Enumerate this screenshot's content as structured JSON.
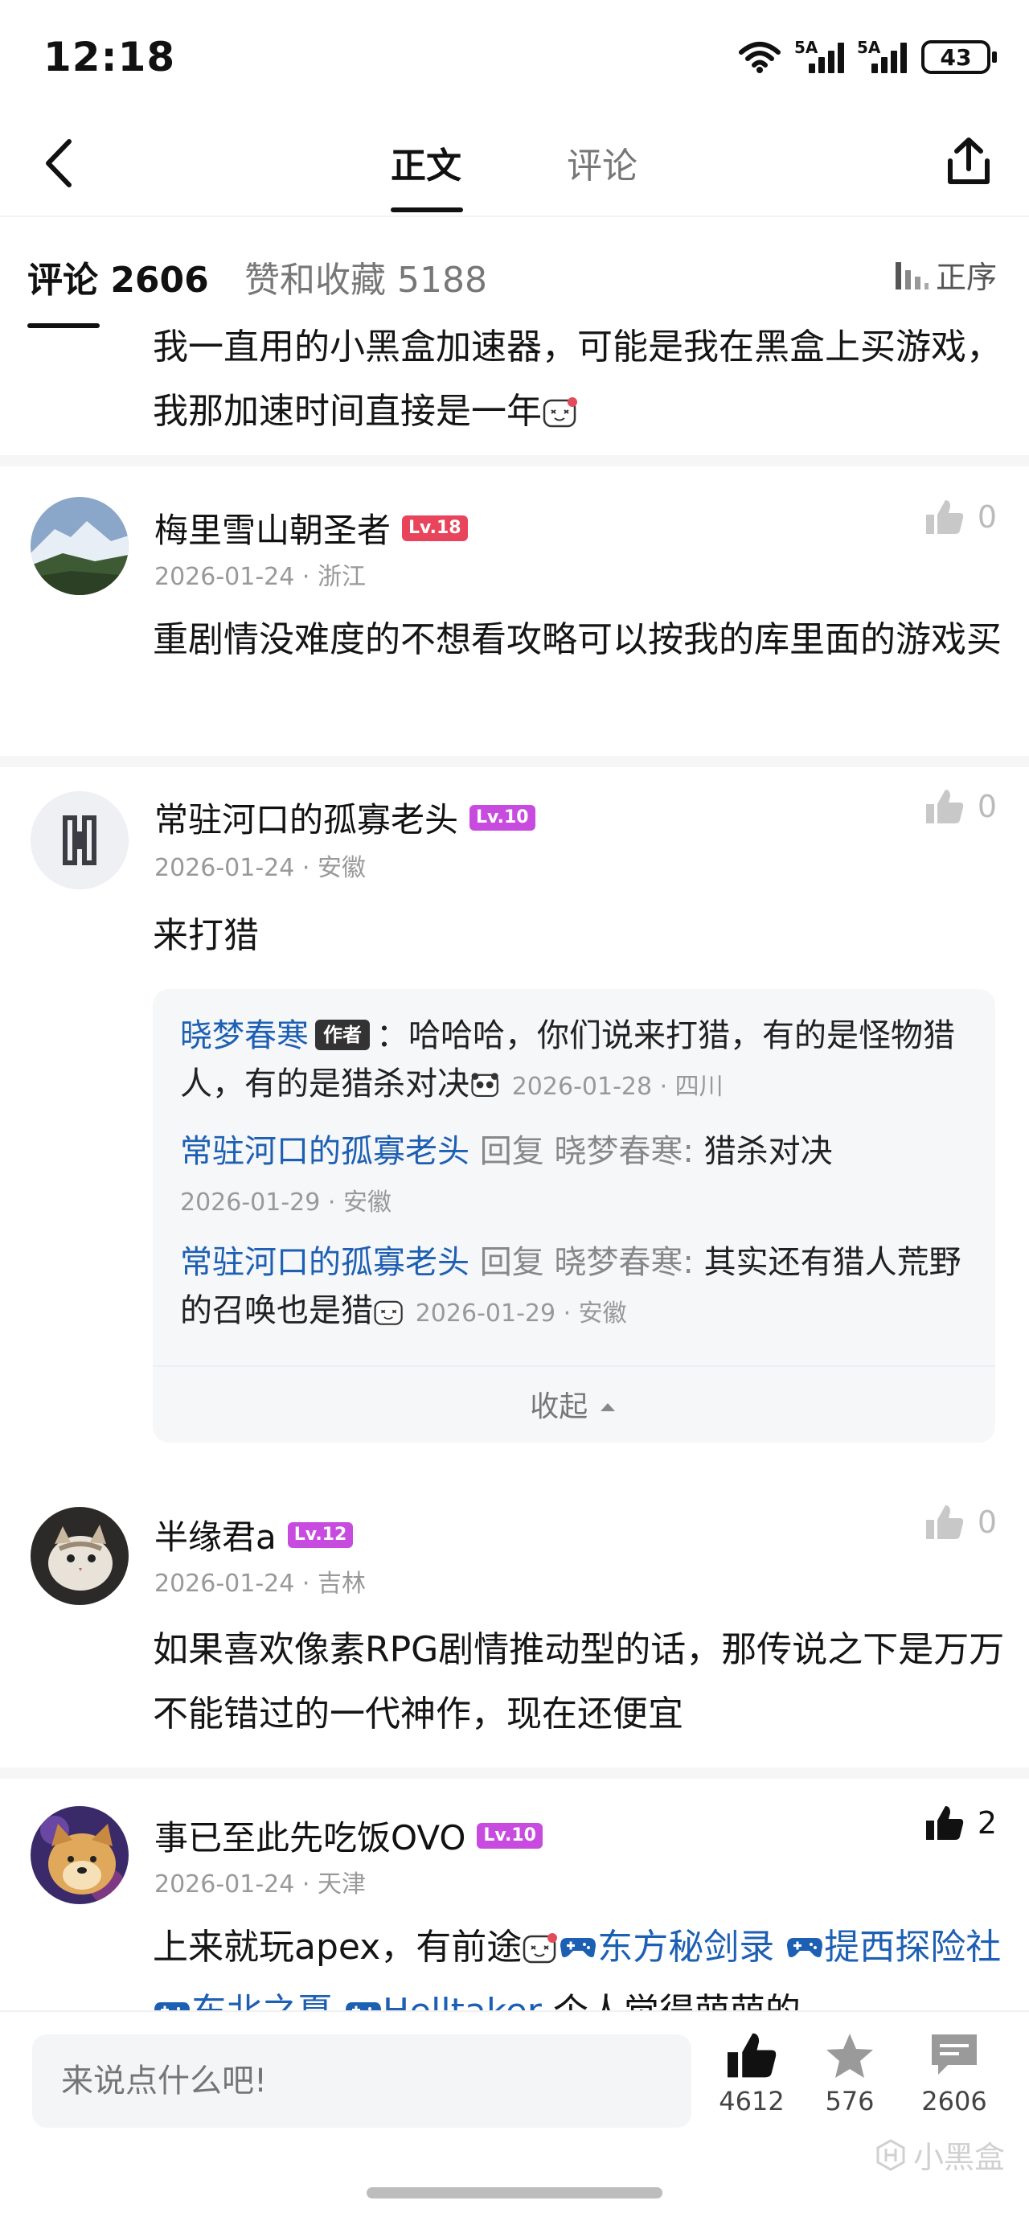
{
  "status_bar": {
    "time": "12:18",
    "signal1": "5A",
    "signal2": "5A",
    "battery": "43"
  },
  "nav": {
    "tab_main": "正文",
    "tab_comment": "评论"
  },
  "subheader": {
    "comments": "评论 2606",
    "likes_favs": "赞和收藏 5188",
    "sort": "正序"
  },
  "first_comment": {
    "text": "我一直用的小黑盒加速器，可能是我在黑盒上买游戏，我那加速时间直接是一年"
  },
  "comments": [
    {
      "name": "梅里雪山朝圣者",
      "level": "Lv.18",
      "meta": "2026-01-24 · 浙江",
      "likes": "0",
      "text": "重剧情没难度的不想看攻略可以按我的库里面的游戏买"
    },
    {
      "name": "常驻河口的孤寡老头",
      "level": "Lv.10",
      "meta": "2026-01-24 · 安徽",
      "likes": "0",
      "text": "来打猎"
    },
    {
      "name": "半缘君a",
      "level": "Lv.12",
      "meta": "2026-01-24 · 吉林",
      "likes": "0",
      "text": "如果喜欢像素RPG剧情推动型的话，那传说之下是万万不能错过的一代神作，现在还便宜"
    },
    {
      "name": "事已至此先吃饭OVO",
      "level": "Lv.10",
      "meta": "2026-01-24 · 天津",
      "likes": "2",
      "text_before": "上来就玩apex，有前途",
      "games": [
        "东方秘剑录",
        "提西探险社",
        "东北之夏",
        "Helltaker"
      ],
      "text_after": "个人觉得萌萌的"
    }
  ],
  "replies": [
    {
      "user": "晓梦春寒",
      "tag": "作者",
      "text": "：哈哈哈，你们说来打猎，有的是怪物猎人，有的是猎杀对决",
      "date": "2026-01-28 · 四川"
    },
    {
      "user": "常驻河口的孤寡老头",
      "reply_word": "回复",
      "target": "晓梦春寒:",
      "text": "猎杀对决",
      "date": "2026-01-29 · 安徽"
    },
    {
      "user": "常驻河口的孤寡老头",
      "reply_word": "回复",
      "target": "晓梦春寒:",
      "text": "其实还有猎人荒野的召唤也是猎",
      "date": "2026-01-29 · 安徽"
    }
  ],
  "collapse": "收起",
  "bottom_bar": {
    "input_placeholder": "来说点什么吧!",
    "likes": "4612",
    "favorites": "576",
    "comments": "2606",
    "watermark": "小黑盒"
  },
  "colors": {
    "link_blue": "#1d5fb3",
    "lv18": "#e8455c",
    "lv10": "#c84be0",
    "lv12": "#c84be0"
  }
}
